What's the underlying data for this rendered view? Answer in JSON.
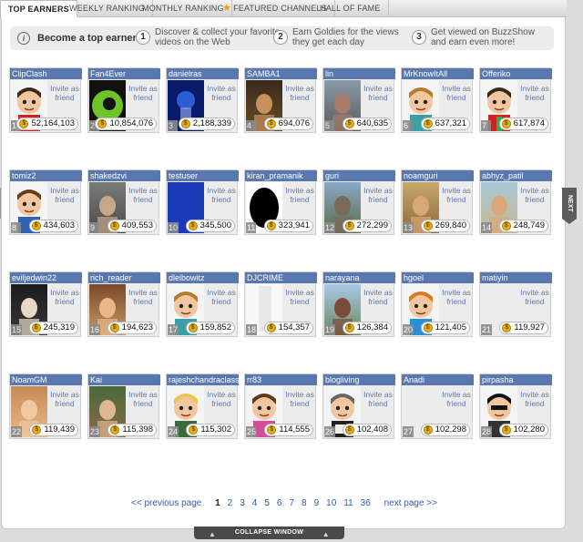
{
  "tabs": [
    {
      "label": "TOP EARNERS",
      "active": true
    },
    {
      "label": "WEEKLY RANKING",
      "active": false
    },
    {
      "label": "MONTHLY RANKING",
      "active": false
    },
    {
      "label": "FEATURED CHANNELS",
      "active": false
    },
    {
      "label": "HALL OF FAME",
      "active": false
    }
  ],
  "banner": {
    "lead": "Become a top earner!",
    "steps": [
      {
        "num": "1",
        "text": "Discover & collect your favorite videos on the Web"
      },
      {
        "num": "2",
        "text": "Earn Goldies for the views they get each day"
      },
      {
        "num": "3",
        "text": "Get viewed on BuzzShow and earn even more!"
      }
    ]
  },
  "invite_label": "Invite as friend",
  "earners": [
    {
      "rank": "1",
      "name": "ClipClash",
      "points": "52,164,103",
      "avatar": "red-cartoon"
    },
    {
      "rank": "2",
      "name": "Fan4Ever",
      "points": "10,854,076",
      "avatar": "green-eye"
    },
    {
      "rank": "3",
      "name": "danielras",
      "points": "2,188,339",
      "avatar": "blue-stage"
    },
    {
      "rank": "4",
      "name": "SAMBA1",
      "points": "694,076",
      "avatar": "dark-photo"
    },
    {
      "rank": "5",
      "name": "lin",
      "points": "640,635",
      "avatar": "street-photo"
    },
    {
      "rank": "6",
      "name": "MrKnowItAll",
      "points": "637,321",
      "avatar": "teal-cartoon"
    },
    {
      "rank": "7",
      "name": "Offeriko",
      "points": "617,874",
      "avatar": "red-cartoon-green"
    },
    {
      "rank": "8",
      "name": "tomiz2",
      "points": "434,603",
      "avatar": "blue-cartoon"
    },
    {
      "rank": "9",
      "name": "shakedzvi",
      "points": "409,553",
      "avatar": "grey-photo"
    },
    {
      "rank": "10",
      "name": "testuser",
      "points": "345,500",
      "avatar": "blue-square"
    },
    {
      "rank": "11",
      "name": "kiran_pramanik",
      "points": "323,941",
      "avatar": "black-silhouette"
    },
    {
      "rank": "12",
      "name": "guri",
      "points": "272,299",
      "avatar": "landscape-photo"
    },
    {
      "rank": "13",
      "name": "noamguri",
      "points": "269,840",
      "avatar": "outdoor-photo"
    },
    {
      "rank": "14",
      "name": "abhyz_patil",
      "points": "248,749",
      "avatar": "beach-photo"
    },
    {
      "rank": "15",
      "name": "eviljedwin22",
      "points": "245,319",
      "avatar": "dark-face-photo"
    },
    {
      "rank": "16",
      "name": "rich_reader",
      "points": "194,623",
      "avatar": "people-photo"
    },
    {
      "rank": "17",
      "name": "dleibowitz",
      "points": "159,852",
      "avatar": "teal-cartoon"
    },
    {
      "rank": "18",
      "name": "DJCRIME",
      "points": "154,357",
      "avatar": "white-blank"
    },
    {
      "rank": "19",
      "name": "narayana",
      "points": "126,384",
      "avatar": "person-photo"
    },
    {
      "rank": "20",
      "name": "hgoel",
      "points": "121,405",
      "avatar": "blue-shirt-cartoon"
    },
    {
      "rank": "21",
      "name": "matiyin",
      "points": "119,927",
      "avatar": "empty"
    },
    {
      "rank": "22",
      "name": "NoamGM",
      "points": "119,439",
      "avatar": "face-photo"
    },
    {
      "rank": "23",
      "name": "Kai",
      "points": "115,398",
      "avatar": "portrait-photo"
    },
    {
      "rank": "24",
      "name": "rajeshchandraclassic",
      "points": "115,302",
      "avatar": "blond-cartoon"
    },
    {
      "rank": "25",
      "name": "rr83",
      "points": "114,555",
      "avatar": "pink-cartoon"
    },
    {
      "rank": "26",
      "name": "blogliving",
      "points": "102,408",
      "avatar": "skull-cartoon"
    },
    {
      "rank": "27",
      "name": "Anadi",
      "points": "102,298",
      "avatar": "empty"
    },
    {
      "rank": "28",
      "name": "pirpasha",
      "points": "102,280",
      "avatar": "sunglasses-cartoon"
    }
  ],
  "pager": {
    "prev": "<< previous page",
    "pages": [
      "1",
      "2",
      "3",
      "4",
      "5",
      "6",
      "7",
      "8",
      "9",
      "10",
      "11",
      "36"
    ],
    "current": "1",
    "next": "next page >>"
  },
  "collapse_label": "COLLAPSE WINDOW",
  "side_next_label": "NEXT",
  "colors": {
    "name_bar": "#5a78b0",
    "panel_bg": "#ffffff",
    "card_bg": "#ececec",
    "coin": "#e3b21a"
  }
}
